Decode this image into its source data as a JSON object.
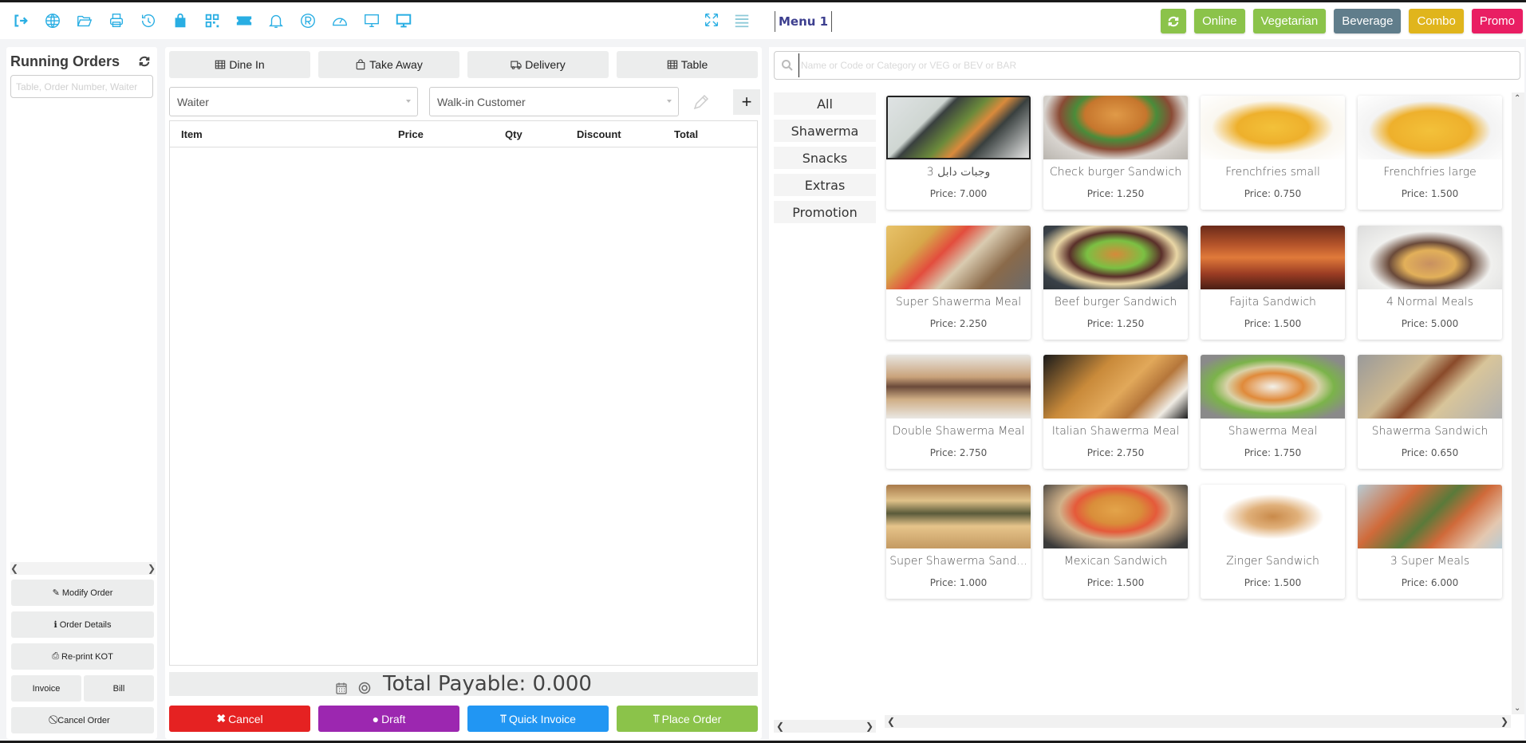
{
  "topbar": {
    "icons": [
      "logout-icon",
      "globe-icon",
      "folder-open-icon",
      "printer-icon",
      "history-icon",
      "shopping-bag-icon",
      "qr-code-icon",
      "ticket-icon",
      "bell-icon",
      "registered-icon",
      "dashboard-gauge-icon",
      "monitor-icon",
      "monitor-filled-icon"
    ],
    "right_icons": [
      "fullscreen-icon",
      "hamburger-menu-icon"
    ],
    "menu_label": "Menu 1",
    "filters": [
      {
        "label": "",
        "icon": "refresh-icon",
        "color": "#8bc34a"
      },
      {
        "label": "Online",
        "color": "#8bc34a"
      },
      {
        "label": "Vegetarian",
        "color": "#8bc34a"
      },
      {
        "label": "Beverage",
        "color": "#607d8b"
      },
      {
        "label": "Combo",
        "color": "#e0b51c"
      },
      {
        "label": "Promo",
        "color": "#e91e63"
      }
    ]
  },
  "running_orders": {
    "title": "Running Orders",
    "search_placeholder": "Table, Order Number, Waiter",
    "buttons": {
      "modify": "Modify Order",
      "details": "Order Details",
      "reprint": "Re-print KOT",
      "invoice": "Invoice",
      "bill": "Bill",
      "cancel": "Cancel Order"
    }
  },
  "order": {
    "types": [
      "Dine In",
      "Take Away",
      "Delivery",
      "Table"
    ],
    "waiter": "Waiter",
    "customer": "Walk-in Customer",
    "columns": [
      "Item",
      "Price",
      "Qty",
      "Discount",
      "Total"
    ],
    "total_label": "Total Payable: 0.000",
    "actions": [
      {
        "label": "Cancel",
        "color": "#e52222",
        "icon": "✖"
      },
      {
        "label": "Draft",
        "color": "#9c27b0",
        "icon": "●"
      },
      {
        "label": "Quick Invoice",
        "color": "#2196f3",
        "icon": "🍴"
      },
      {
        "label": "Place Order",
        "color": "#8bc34a",
        "icon": "🍴"
      }
    ]
  },
  "products": {
    "search_placeholder": "Name or Code or Category or VEG or BEV or BAR",
    "categories": [
      "All",
      "Shawerma",
      "Snacks",
      "Extras",
      "Promotion"
    ],
    "items": [
      {
        "name": "وجبات دابل 3",
        "price": "Price: 7.000"
      },
      {
        "name": "Check burger Sandwich",
        "price": "Price: 1.250"
      },
      {
        "name": "Frenchfries small",
        "price": "Price: 0.750"
      },
      {
        "name": "Frenchfries large",
        "price": "Price: 1.500"
      },
      {
        "name": "Super Shawerma Meal",
        "price": "Price: 2.250"
      },
      {
        "name": "Beef burger Sandwich",
        "price": "Price: 1.250"
      },
      {
        "name": "Fajita Sandwich",
        "price": "Price: 1.500"
      },
      {
        "name": "4 Normal Meals",
        "price": "Price: 5.000"
      },
      {
        "name": "Double Shawerma Meal",
        "price": "Price: 2.750"
      },
      {
        "name": "Italian Shawerma Meal",
        "price": "Price: 2.750"
      },
      {
        "name": "Shawerma Meal",
        "price": "Price: 1.750"
      },
      {
        "name": "Shawerma Sandwich",
        "price": "Price: 0.650"
      },
      {
        "name": "Super Shawerma Sand...",
        "price": "Price: 1.000"
      },
      {
        "name": "Mexican Sandwich",
        "price": "Price: 1.500"
      },
      {
        "name": "Zinger Sandwich",
        "price": "Price: 1.500"
      },
      {
        "name": "3 Super Meals",
        "price": "Price: 6.000"
      }
    ]
  }
}
